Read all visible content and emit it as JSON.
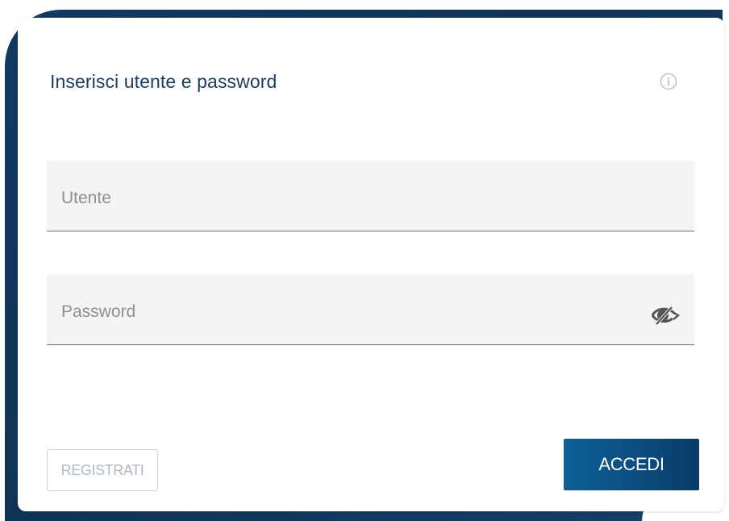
{
  "login": {
    "title": "Inserisci utente e password",
    "username_placeholder": "Utente",
    "username_value": "",
    "password_placeholder": "Password",
    "password_value": "",
    "register_label": "REGISTRATI",
    "login_label": "ACCEDI"
  },
  "icons": {
    "info": "info-icon",
    "password_toggle": "eye-slash-icon"
  },
  "colors": {
    "background_panel": "#123a5f",
    "title": "#1c3d5e",
    "primary_button": "#0b4f83",
    "field_background": "#f4f4f4"
  }
}
